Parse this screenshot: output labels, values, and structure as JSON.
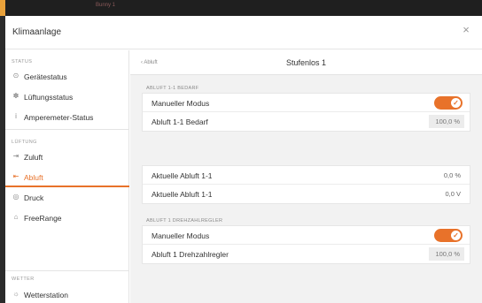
{
  "window": {
    "background_title": "Bunny 1"
  },
  "dialog": {
    "title": "Klimaanlage",
    "close_glyph": "×"
  },
  "sidebar": {
    "status_label": "STATUS",
    "status_items": [
      {
        "icon": "wifi-icon",
        "glyph": "⊙",
        "label": "Gerätestatus"
      },
      {
        "icon": "fan-icon",
        "glyph": "✽",
        "label": "Lüftungsstatus"
      },
      {
        "icon": "info-icon",
        "glyph": "i",
        "label": "Amperemeter-Status"
      }
    ],
    "lueftung_label": "LÜFTUNG",
    "lueftung_items": [
      {
        "icon": "inlet-icon",
        "glyph": "⇥",
        "label": "Zuluft",
        "active": false
      },
      {
        "icon": "outlet-icon",
        "glyph": "⇤",
        "label": "Abluft",
        "active": true
      },
      {
        "icon": "pressure-icon",
        "glyph": "◎",
        "label": "Druck",
        "active": false
      },
      {
        "icon": "range-icon",
        "glyph": "⌂",
        "label": "FreeRange",
        "active": false
      }
    ],
    "wetter_label": "WETTER",
    "wetter_items": [
      {
        "icon": "weather-station-icon",
        "glyph": "☼",
        "label": "Wetterstation"
      }
    ]
  },
  "content": {
    "back_label": "‹ Abluft",
    "title": "Stufenlos 1",
    "group1_label": "ABLUFT 1-1 BEDARF",
    "group1": {
      "manual_label": "Manueller Modus",
      "manual_on": true,
      "bedarf_label": "Abluft 1-1 Bedarf",
      "bedarf_value": "100,0 %"
    },
    "group2": {
      "row1_label": "Aktuelle Abluft 1-1",
      "row1_value": "0,0 %",
      "row2_label": "Aktuelle Abluft 1-1",
      "row2_value": "0,0 V"
    },
    "group3_label": "ABLUFT 1 DREHZAHLREGLER",
    "group3": {
      "manual_label": "Manueller Modus",
      "manual_on": true,
      "regler_label": "Abluft 1 Drehzahlregler",
      "regler_value": "100,0 %"
    },
    "toggle_check": "✓"
  },
  "colors": {
    "accent": "#e8722a",
    "topbar_accent": "#e8a13a"
  }
}
